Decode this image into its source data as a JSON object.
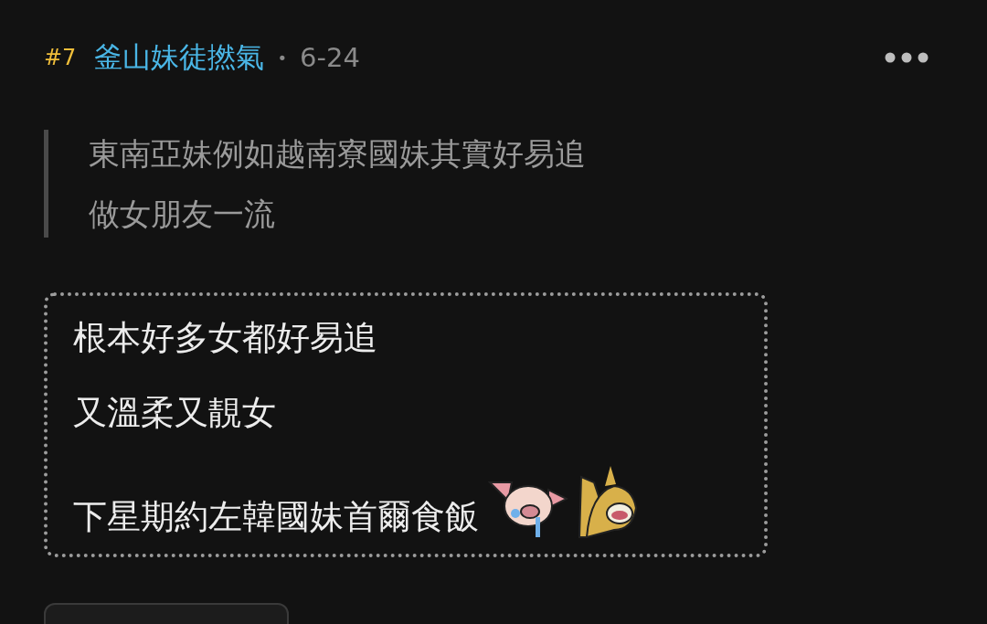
{
  "post": {
    "floor": "#7",
    "author": "釜山妹徒撚氣",
    "separator": "•",
    "date": "6-24",
    "quote": [
      "東南亞妹例如越南寮國妹其實好易追",
      "做女朋友一流"
    ],
    "body": [
      "根本好多女都好易追",
      "又溫柔又靚女",
      "下星期約左韓國妹首爾食飯"
    ]
  }
}
